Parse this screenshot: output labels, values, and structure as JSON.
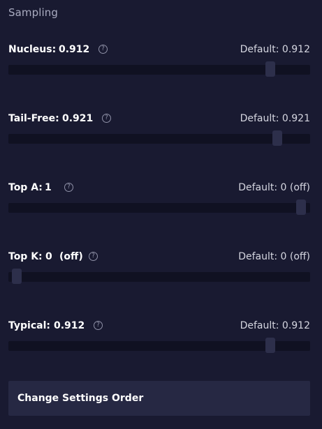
{
  "section": {
    "title": "Sampling"
  },
  "settings": [
    {
      "id": "nucleus",
      "label": "Nucleus:",
      "value": "0.912",
      "suffix": "",
      "help_icon": "help-circle-icon",
      "help_glyph": "?",
      "default_label": "Default: 0.912",
      "slider_position": 0.88
    },
    {
      "id": "tail-free",
      "label": "Tail-Free:",
      "value": "0.921",
      "suffix": "",
      "help_icon": "help-circle-icon",
      "help_glyph": "?",
      "default_label": "Default: 0.921",
      "slider_position": 0.905
    },
    {
      "id": "top-a",
      "label": "Top A:",
      "value": "1",
      "suffix": "",
      "help_icon": "help-circle-icon",
      "help_glyph": "?",
      "default_label": "Default: 0 (off)",
      "slider_position": 0.985
    },
    {
      "id": "top-k",
      "label": "Top K:",
      "value": "0",
      "suffix": "(off)",
      "help_icon": "help-circle-icon",
      "help_glyph": "?",
      "default_label": "Default: 0 (off)",
      "slider_position": 0.012
    },
    {
      "id": "typical",
      "label": "Typical:",
      "value": "0.912",
      "suffix": "",
      "help_icon": "help-circle-icon",
      "help_glyph": "?",
      "default_label": "Default: 0.912",
      "slider_position": 0.88
    }
  ],
  "actions": {
    "change_order_label": "Change Settings Order"
  },
  "colors": {
    "background": "#191a31",
    "track": "#101122",
    "thumb": "#2d2f4b",
    "button": "#262843",
    "muted_text": "#a9abc0"
  }
}
